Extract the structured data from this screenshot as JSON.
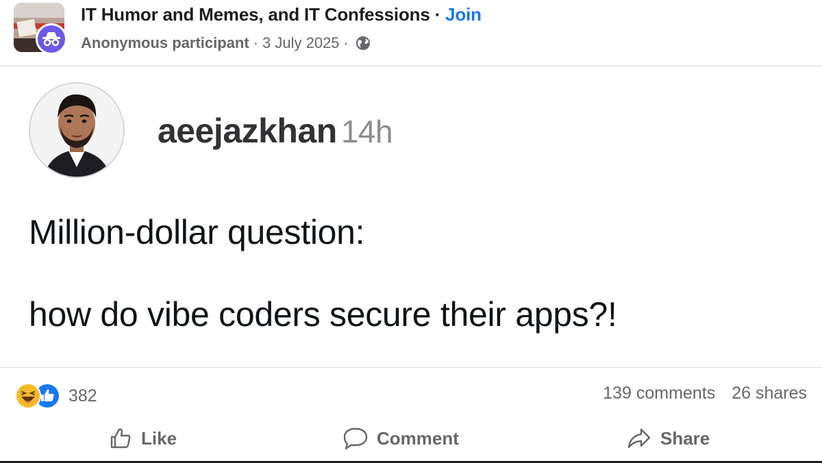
{
  "header": {
    "group_name": "IT Humor and Memes, and IT Confessions",
    "separator": "·",
    "join_label": "Join",
    "author": "Anonymous participant",
    "date": "3 July 2025",
    "privacy_icon": "globe-icon",
    "badge_icon": "incognito-icon"
  },
  "embedded_post": {
    "username": "aeejazkhan",
    "time_ago": "14h",
    "line1": "Million-dollar question:",
    "line2": "how do vibe coders secure their apps?!"
  },
  "reactions": {
    "icons": [
      "haha-icon",
      "like-icon"
    ],
    "count": "382",
    "comments": "139 comments",
    "shares": "26 shares"
  },
  "actions": {
    "like_label": "Like",
    "comment_label": "Comment",
    "share_label": "Share"
  },
  "colors": {
    "accent": "#1877f2",
    "badge": "#6d5ae6",
    "muted_text": "#65676b",
    "haha": "#f7b928"
  }
}
